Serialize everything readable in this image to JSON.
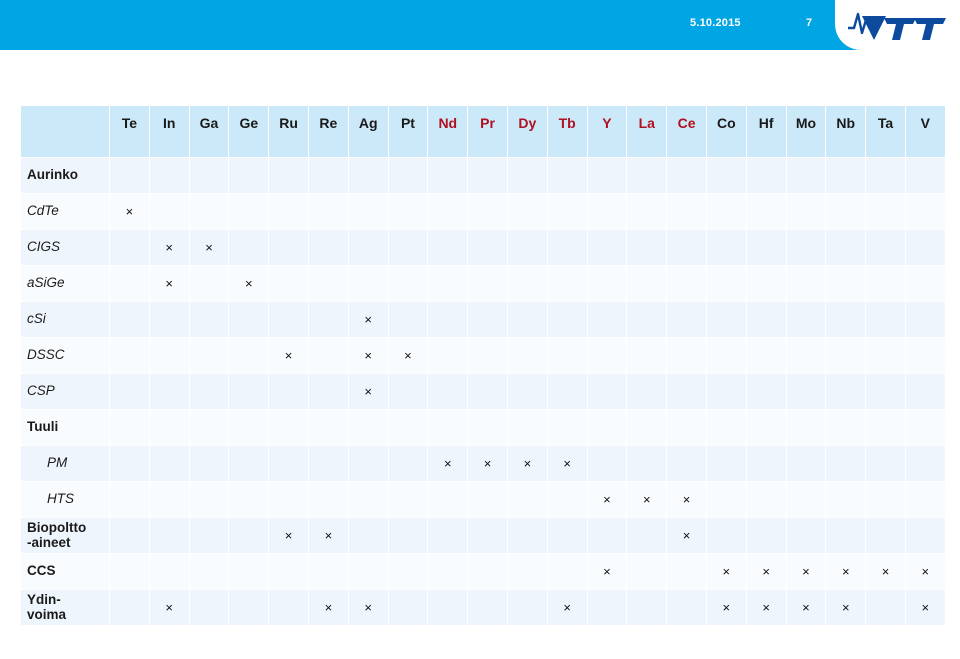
{
  "banner": {
    "date": "5.10.2015",
    "page_number": "7",
    "logo_name": "VTT"
  },
  "matrix": {
    "columns": [
      {
        "symbol": "Te",
        "critical": false
      },
      {
        "symbol": "In",
        "critical": false
      },
      {
        "symbol": "Ga",
        "critical": false
      },
      {
        "symbol": "Ge",
        "critical": false
      },
      {
        "symbol": "Ru",
        "critical": false
      },
      {
        "symbol": "Re",
        "critical": false
      },
      {
        "symbol": "Ag",
        "critical": false
      },
      {
        "symbol": "Pt",
        "critical": false
      },
      {
        "symbol": "Nd",
        "critical": true
      },
      {
        "symbol": "Pr",
        "critical": true
      },
      {
        "symbol": "Dy",
        "critical": true
      },
      {
        "symbol": "Tb",
        "critical": true
      },
      {
        "symbol": "Y",
        "critical": true
      },
      {
        "symbol": "La",
        "critical": true
      },
      {
        "symbol": "Ce",
        "critical": true
      },
      {
        "symbol": "Co",
        "critical": false
      },
      {
        "symbol": "Hf",
        "critical": false
      },
      {
        "symbol": "Mo",
        "critical": false
      },
      {
        "symbol": "Nb",
        "critical": false
      },
      {
        "symbol": "Ta",
        "critical": false
      },
      {
        "symbol": "V",
        "critical": false
      }
    ],
    "mark_glyph": "×",
    "rows": [
      {
        "label": "Aurinko",
        "style": "group",
        "marks": []
      },
      {
        "label": "CdTe",
        "style": "sub",
        "marks": [
          "Te"
        ]
      },
      {
        "label": "CIGS",
        "style": "sub",
        "marks": [
          "In",
          "Ga"
        ]
      },
      {
        "label": "aSiGe",
        "style": "sub",
        "marks": [
          "In",
          "Ge"
        ]
      },
      {
        "label": "cSi",
        "style": "sub",
        "marks": [
          "Ag"
        ]
      },
      {
        "label": "DSSC",
        "style": "sub",
        "marks": [
          "Ru",
          "Ag",
          "Pt"
        ]
      },
      {
        "label": "CSP",
        "style": "sub",
        "marks": [
          "Ag"
        ]
      },
      {
        "label": "Tuuli",
        "style": "group",
        "marks": []
      },
      {
        "label": "PM",
        "style": "sub-indent",
        "marks": [
          "Nd",
          "Pr",
          "Dy",
          "Tb"
        ]
      },
      {
        "label": "HTS",
        "style": "sub-indent",
        "marks": [
          "Y",
          "La",
          "Ce"
        ]
      },
      {
        "label": "Biopoltto\n-aineet",
        "style": "group-tall",
        "marks": [
          "Ru",
          "Re",
          "Ce"
        ]
      },
      {
        "label": "CCS",
        "style": "group",
        "marks": [
          "Y",
          "Co",
          "Hf",
          "Mo",
          "Nb",
          "Ta",
          "V"
        ]
      },
      {
        "label": "Ydin-\nvoima",
        "style": "group-tall",
        "marks": [
          "In",
          "Re",
          "Ag",
          "Tb",
          "Co",
          "Hf",
          "Mo",
          "Nb",
          "V"
        ]
      }
    ]
  },
  "colors": {
    "banner": "#00a5e3",
    "header_cell": "#cbe9f8",
    "critical_element": "#b01020",
    "band_a": "#eff5fc",
    "band_b": "#f9fcfe"
  }
}
